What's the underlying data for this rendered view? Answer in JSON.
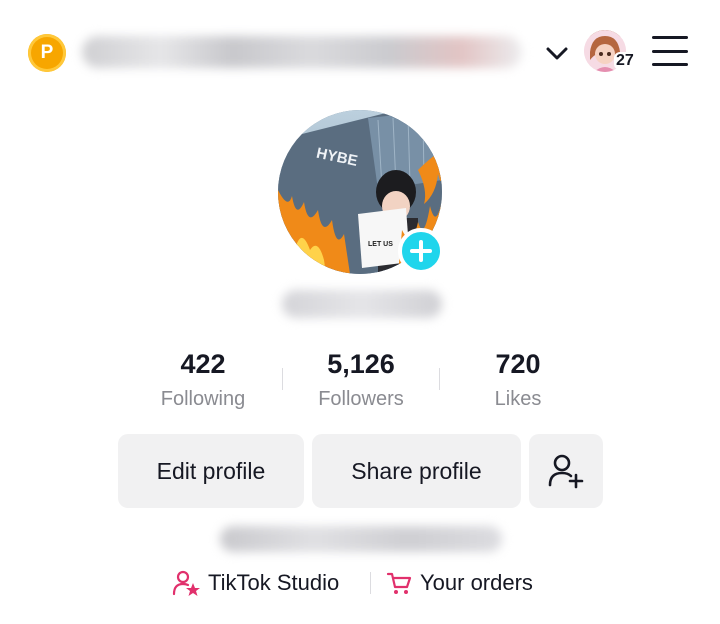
{
  "header": {
    "points_badge": "P",
    "notification_count": "27",
    "icons": {
      "chevron": "chevron-down-icon",
      "menu": "hamburger-menu-icon"
    }
  },
  "profile": {
    "photo_sign_text": "HYBE",
    "photo_paper_text": "LET US"
  },
  "stats": [
    {
      "value": "422",
      "label": "Following"
    },
    {
      "value": "5,126",
      "label": "Followers"
    },
    {
      "value": "720",
      "label": "Likes"
    }
  ],
  "buttons": {
    "edit_profile": "Edit profile",
    "share_profile": "Share profile"
  },
  "links": {
    "studio": "TikTok Studio",
    "orders": "Your orders"
  },
  "colors": {
    "accent_cyan": "#20d5ec",
    "link_icon_pink": "#e1306c",
    "points_yellow": "#f7a600",
    "button_bg": "#f1f1f2"
  }
}
